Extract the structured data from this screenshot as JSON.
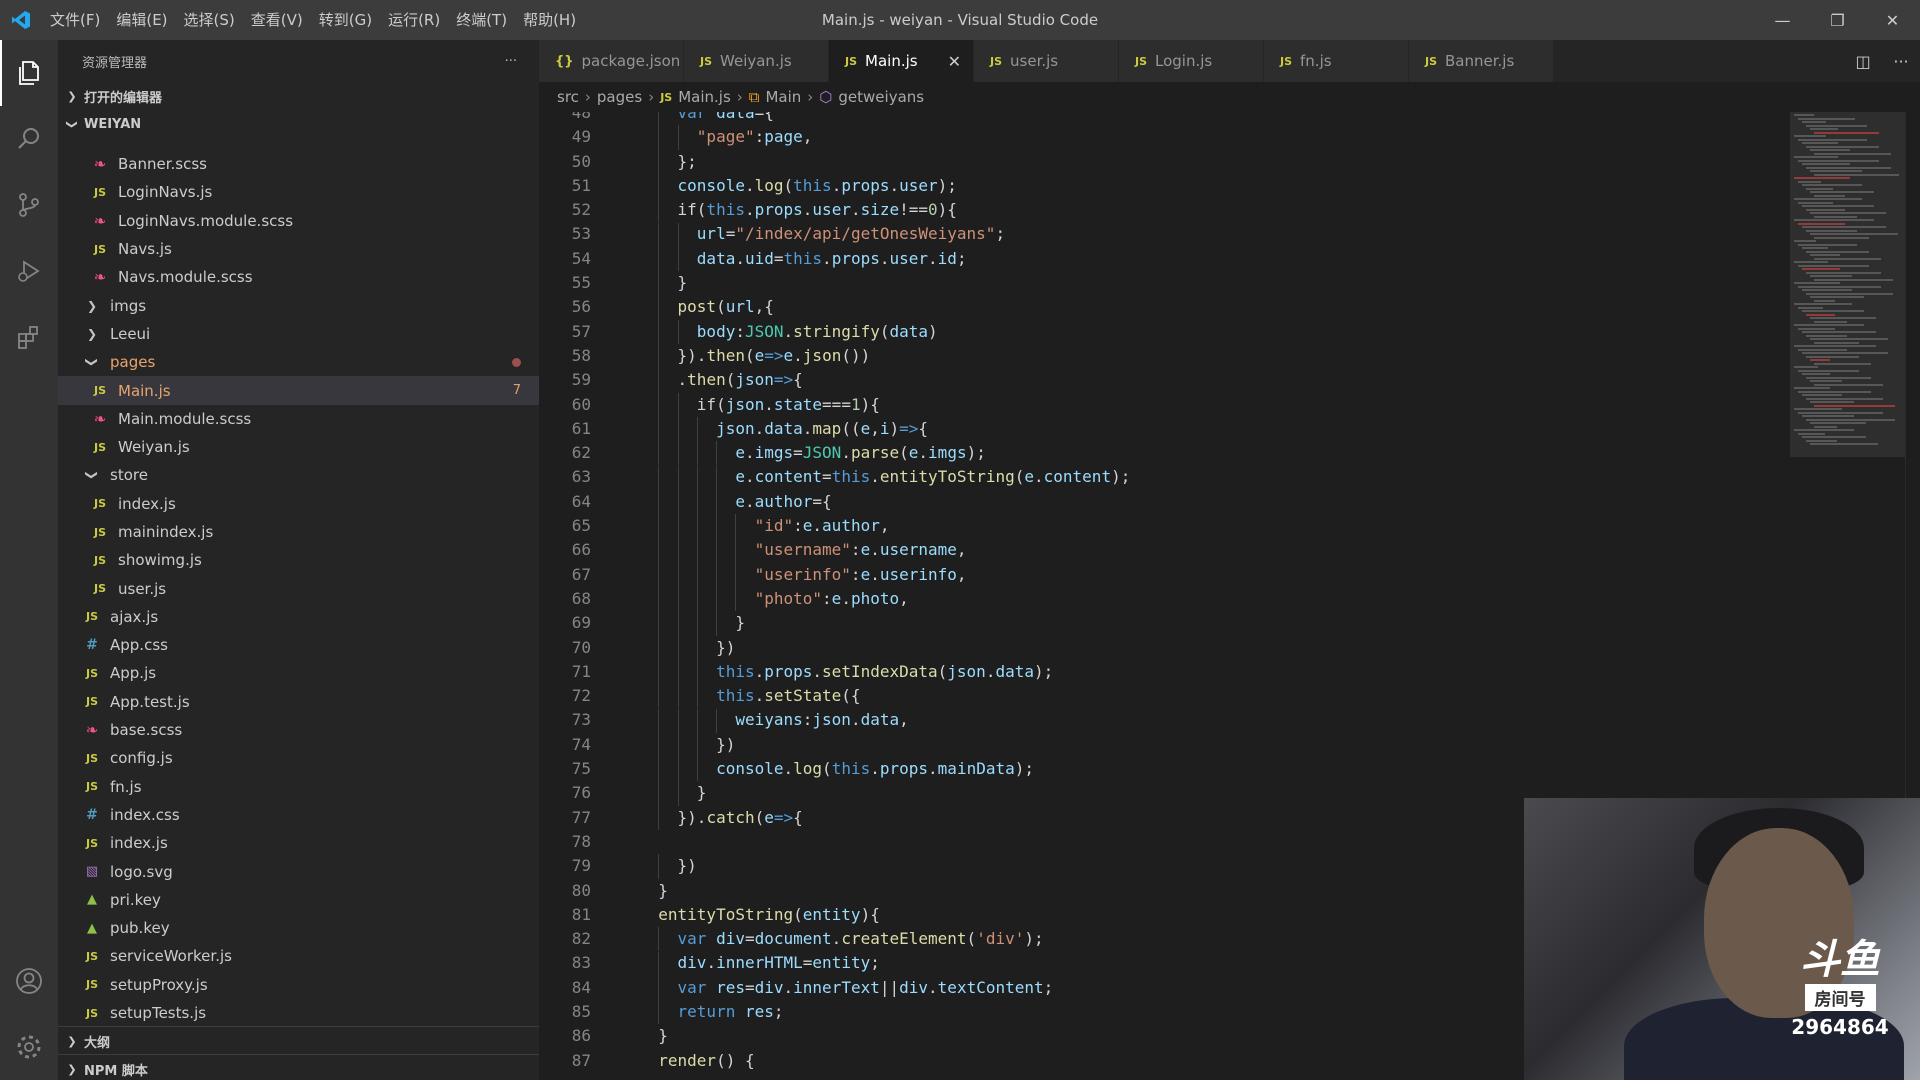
{
  "window": {
    "title": "Main.js - weiyan - Visual Studio Code",
    "menu": [
      "文件(F)",
      "编辑(E)",
      "选择(S)",
      "查看(V)",
      "转到(G)",
      "运行(R)",
      "终端(T)",
      "帮助(H)"
    ]
  },
  "sidebar": {
    "header": "资源管理器",
    "open_editors": "打开的编辑器",
    "project": "WEIYAN",
    "outline": "大纲",
    "npm": "NPM 脚本"
  },
  "tree": [
    {
      "name": "Banner.scss",
      "type": "scss",
      "indent": 3
    },
    {
      "name": "LoginNavs.js",
      "type": "js",
      "indent": 3
    },
    {
      "name": "LoginNavs.module.scss",
      "type": "scss",
      "indent": 3
    },
    {
      "name": "Navs.js",
      "type": "js",
      "indent": 3
    },
    {
      "name": "Navs.module.scss",
      "type": "scss",
      "indent": 3
    },
    {
      "name": "imgs",
      "type": "folder-closed",
      "indent": 2
    },
    {
      "name": "Leeui",
      "type": "folder-closed",
      "indent": 2
    },
    {
      "name": "pages",
      "type": "folder-open",
      "indent": 2,
      "modified": true
    },
    {
      "name": "Main.js",
      "type": "js",
      "indent": 3,
      "selected": true,
      "badge": "7"
    },
    {
      "name": "Main.module.scss",
      "type": "scss",
      "indent": 3
    },
    {
      "name": "Weiyan.js",
      "type": "js",
      "indent": 3
    },
    {
      "name": "store",
      "type": "folder-open",
      "indent": 2
    },
    {
      "name": "index.js",
      "type": "js",
      "indent": 3
    },
    {
      "name": "mainindex.js",
      "type": "js",
      "indent": 3
    },
    {
      "name": "showimg.js",
      "type": "js",
      "indent": 3
    },
    {
      "name": "user.js",
      "type": "js",
      "indent": 3
    },
    {
      "name": "ajax.js",
      "type": "js",
      "indent": 2
    },
    {
      "name": "App.css",
      "type": "css",
      "indent": 2
    },
    {
      "name": "App.js",
      "type": "js",
      "indent": 2
    },
    {
      "name": "App.test.js",
      "type": "js",
      "indent": 2
    },
    {
      "name": "base.scss",
      "type": "scss",
      "indent": 2
    },
    {
      "name": "config.js",
      "type": "js",
      "indent": 2
    },
    {
      "name": "fn.js",
      "type": "js",
      "indent": 2
    },
    {
      "name": "index.css",
      "type": "css",
      "indent": 2
    },
    {
      "name": "index.js",
      "type": "js",
      "indent": 2
    },
    {
      "name": "logo.svg",
      "type": "svg",
      "indent": 2
    },
    {
      "name": "pri.key",
      "type": "key",
      "indent": 2
    },
    {
      "name": "pub.key",
      "type": "key",
      "indent": 2
    },
    {
      "name": "serviceWorker.js",
      "type": "js",
      "indent": 2
    },
    {
      "name": "setupProxy.js",
      "type": "js",
      "indent": 2
    },
    {
      "name": "setupTests.js",
      "type": "js",
      "indent": 2
    }
  ],
  "tabs": [
    {
      "label": "package.json",
      "icon": "{}",
      "active": false
    },
    {
      "label": "Weiyan.js",
      "icon": "JS",
      "active": false
    },
    {
      "label": "Main.js",
      "icon": "JS",
      "active": true
    },
    {
      "label": "user.js",
      "icon": "JS",
      "active": false
    },
    {
      "label": "Login.js",
      "icon": "JS",
      "active": false
    },
    {
      "label": "fn.js",
      "icon": "JS",
      "active": false
    },
    {
      "label": "Banner.js",
      "icon": "JS",
      "active": false
    }
  ],
  "breadcrumb": {
    "src": "src",
    "pages": "pages",
    "file": "Main.js",
    "cls": "Main",
    "method": "getweiyans"
  },
  "code": {
    "first_line": 48,
    "lines": [
      [
        [
          2,
          ""
        ],
        [
          "k",
          "var "
        ],
        [
          "p",
          "data"
        ],
        [
          "",
          "={"
        ]
      ],
      [
        [
          3,
          ""
        ],
        [
          "s",
          "\"page\""
        ],
        [
          "",
          ":"
        ],
        [
          "p",
          "page"
        ],
        [
          "",
          ","
        ]
      ],
      [
        [
          2,
          ""
        ],
        [
          "",
          "};"
        ]
      ],
      [
        [
          2,
          ""
        ],
        [
          "p",
          "console"
        ],
        [
          "",
          "."
        ],
        [
          "f",
          "log"
        ],
        [
          "",
          "("
        ],
        [
          "k",
          "this"
        ],
        [
          "",
          "."
        ],
        [
          "p",
          "props"
        ],
        [
          "",
          "."
        ],
        [
          "p",
          "user"
        ],
        [
          "",
          ");"
        ]
      ],
      [
        [
          2,
          ""
        ],
        [
          "",
          "if("
        ],
        [
          "k",
          "this"
        ],
        [
          "",
          "."
        ],
        [
          "p",
          "props"
        ],
        [
          "",
          "."
        ],
        [
          "p",
          "user"
        ],
        [
          "",
          "."
        ],
        [
          "p",
          "size"
        ],
        [
          "",
          "!=="
        ],
        [
          "n",
          "0"
        ],
        [
          "",
          "){"
        ]
      ],
      [
        [
          3,
          ""
        ],
        [
          "p",
          "url"
        ],
        [
          "",
          "="
        ],
        [
          "s",
          "\"/index/api/getOnesWeiyans\""
        ],
        [
          "",
          ";"
        ]
      ],
      [
        [
          3,
          ""
        ],
        [
          "p",
          "data"
        ],
        [
          "",
          "."
        ],
        [
          "p",
          "uid"
        ],
        [
          "",
          "="
        ],
        [
          "k",
          "this"
        ],
        [
          "",
          "."
        ],
        [
          "p",
          "props"
        ],
        [
          "",
          "."
        ],
        [
          "p",
          "user"
        ],
        [
          "",
          "."
        ],
        [
          "p",
          "id"
        ],
        [
          "",
          ";"
        ]
      ],
      [
        [
          2,
          ""
        ],
        [
          "",
          "}"
        ]
      ],
      [
        [
          2,
          ""
        ],
        [
          "f",
          "post"
        ],
        [
          "",
          "("
        ],
        [
          "p",
          "url"
        ],
        [
          "",
          ",{"
        ]
      ],
      [
        [
          3,
          ""
        ],
        [
          "p",
          "body"
        ],
        [
          "",
          ":"
        ],
        [
          "c",
          "JSON"
        ],
        [
          "",
          "."
        ],
        [
          "f",
          "stringify"
        ],
        [
          "",
          "("
        ],
        [
          "p",
          "data"
        ],
        [
          "",
          ")"
        ]
      ],
      [
        [
          2,
          ""
        ],
        [
          "",
          "})."
        ],
        [
          "f",
          "then"
        ],
        [
          "",
          "("
        ],
        [
          "p",
          "e"
        ],
        [
          "k",
          "=>"
        ],
        [
          "p",
          "e"
        ],
        [
          "",
          "."
        ],
        [
          "f",
          "json"
        ],
        [
          "",
          "())"
        ]
      ],
      [
        [
          2,
          ""
        ],
        [
          "",
          "."
        ],
        [
          "f",
          "then"
        ],
        [
          "",
          "("
        ],
        [
          "p",
          "json"
        ],
        [
          "k",
          "=>"
        ],
        [
          "",
          "{"
        ]
      ],
      [
        [
          3,
          ""
        ],
        [
          "",
          "if("
        ],
        [
          "p",
          "json"
        ],
        [
          "",
          "."
        ],
        [
          "p",
          "state"
        ],
        [
          "",
          "==="
        ],
        [
          "n",
          "1"
        ],
        [
          "",
          "){"
        ]
      ],
      [
        [
          4,
          ""
        ],
        [
          "p",
          "json"
        ],
        [
          "",
          "."
        ],
        [
          "p",
          "data"
        ],
        [
          "",
          "."
        ],
        [
          "f",
          "map"
        ],
        [
          "",
          "(("
        ],
        [
          "p",
          "e"
        ],
        [
          "",
          ","
        ],
        [
          "p",
          "i"
        ],
        [
          "",
          ")"
        ],
        [
          "k",
          "=>"
        ],
        [
          "",
          "{"
        ]
      ],
      [
        [
          5,
          ""
        ],
        [
          "p",
          "e"
        ],
        [
          "",
          "."
        ],
        [
          "p",
          "imgs"
        ],
        [
          "",
          "="
        ],
        [
          "c",
          "JSON"
        ],
        [
          "",
          "."
        ],
        [
          "f",
          "parse"
        ],
        [
          "",
          "("
        ],
        [
          "p",
          "e"
        ],
        [
          "",
          "."
        ],
        [
          "p",
          "imgs"
        ],
        [
          "",
          ");"
        ]
      ],
      [
        [
          5,
          ""
        ],
        [
          "p",
          "e"
        ],
        [
          "",
          "."
        ],
        [
          "p",
          "content"
        ],
        [
          "",
          "="
        ],
        [
          "k",
          "this"
        ],
        [
          "",
          "."
        ],
        [
          "f",
          "entityToString"
        ],
        [
          "",
          "("
        ],
        [
          "p",
          "e"
        ],
        [
          "",
          "."
        ],
        [
          "p",
          "content"
        ],
        [
          "",
          ");"
        ]
      ],
      [
        [
          5,
          ""
        ],
        [
          "p",
          "e"
        ],
        [
          "",
          "."
        ],
        [
          "p",
          "author"
        ],
        [
          "",
          "={"
        ]
      ],
      [
        [
          6,
          ""
        ],
        [
          "s",
          "\"id\""
        ],
        [
          "",
          ":"
        ],
        [
          "p",
          "e"
        ],
        [
          "",
          "."
        ],
        [
          "p",
          "author"
        ],
        [
          "",
          ","
        ]
      ],
      [
        [
          6,
          ""
        ],
        [
          "s",
          "\"username\""
        ],
        [
          "",
          ":"
        ],
        [
          "p",
          "e"
        ],
        [
          "",
          "."
        ],
        [
          "p",
          "username"
        ],
        [
          "",
          ","
        ]
      ],
      [
        [
          6,
          ""
        ],
        [
          "s",
          "\"userinfo\""
        ],
        [
          "",
          ":"
        ],
        [
          "p",
          "e"
        ],
        [
          "",
          "."
        ],
        [
          "p",
          "userinfo"
        ],
        [
          "",
          ","
        ]
      ],
      [
        [
          6,
          ""
        ],
        [
          "s",
          "\"photo\""
        ],
        [
          "",
          ":"
        ],
        [
          "p",
          "e"
        ],
        [
          "",
          "."
        ],
        [
          "p",
          "photo"
        ],
        [
          "",
          ","
        ]
      ],
      [
        [
          5,
          ""
        ],
        [
          "",
          "}"
        ]
      ],
      [
        [
          4,
          ""
        ],
        [
          "",
          "})"
        ]
      ],
      [
        [
          4,
          ""
        ],
        [
          "k",
          "this"
        ],
        [
          "",
          "."
        ],
        [
          "p",
          "props"
        ],
        [
          "",
          "."
        ],
        [
          "f",
          "setIndexData"
        ],
        [
          "",
          "("
        ],
        [
          "p",
          "json"
        ],
        [
          "",
          "."
        ],
        [
          "p",
          "data"
        ],
        [
          "",
          ");"
        ]
      ],
      [
        [
          4,
          ""
        ],
        [
          "k",
          "this"
        ],
        [
          "",
          "."
        ],
        [
          "f",
          "setState"
        ],
        [
          "",
          "({"
        ]
      ],
      [
        [
          5,
          ""
        ],
        [
          "p",
          "weiyans"
        ],
        [
          "",
          ":"
        ],
        [
          "p",
          "json"
        ],
        [
          "",
          "."
        ],
        [
          "p",
          "data"
        ],
        [
          "",
          ","
        ]
      ],
      [
        [
          4,
          ""
        ],
        [
          "",
          "})"
        ]
      ],
      [
        [
          4,
          ""
        ],
        [
          "p",
          "console"
        ],
        [
          "",
          "."
        ],
        [
          "f",
          "log"
        ],
        [
          "",
          "("
        ],
        [
          "k",
          "this"
        ],
        [
          "",
          "."
        ],
        [
          "p",
          "props"
        ],
        [
          "",
          "."
        ],
        [
          "p",
          "mainData"
        ],
        [
          "",
          ");"
        ]
      ],
      [
        [
          3,
          ""
        ],
        [
          "",
          "}"
        ]
      ],
      [
        [
          2,
          ""
        ],
        [
          "",
          "})."
        ],
        [
          "f",
          "catch"
        ],
        [
          "",
          "("
        ],
        [
          "p",
          "e"
        ],
        [
          "k",
          "=>"
        ],
        [
          "",
          "{"
        ]
      ],
      [
        [
          0,
          ""
        ]
      ],
      [
        [
          2,
          ""
        ],
        [
          "",
          "})"
        ]
      ],
      [
        [
          1,
          ""
        ],
        [
          "",
          "}"
        ]
      ],
      [
        [
          1,
          ""
        ],
        [
          "f",
          "entityToString"
        ],
        [
          "",
          "("
        ],
        [
          "p",
          "entity"
        ],
        [
          "",
          "){"
        ]
      ],
      [
        [
          2,
          ""
        ],
        [
          "k",
          "var "
        ],
        [
          "p",
          "div"
        ],
        [
          "",
          "="
        ],
        [
          "p",
          "document"
        ],
        [
          "",
          "."
        ],
        [
          "f",
          "createElement"
        ],
        [
          "",
          "("
        ],
        [
          "s",
          "'div'"
        ],
        [
          "",
          ");"
        ]
      ],
      [
        [
          2,
          ""
        ],
        [
          "p",
          "div"
        ],
        [
          "",
          "."
        ],
        [
          "p",
          "innerHTML"
        ],
        [
          "",
          "="
        ],
        [
          "p",
          "entity"
        ],
        [
          "",
          ";"
        ]
      ],
      [
        [
          2,
          ""
        ],
        [
          "k",
          "var "
        ],
        [
          "p",
          "res"
        ],
        [
          "",
          "="
        ],
        [
          "p",
          "div"
        ],
        [
          "",
          "."
        ],
        [
          "p",
          "innerText"
        ],
        [
          "",
          "||"
        ],
        [
          "p",
          "div"
        ],
        [
          "",
          "."
        ],
        [
          "p",
          "textContent"
        ],
        [
          "",
          ";"
        ]
      ],
      [
        [
          2,
          ""
        ],
        [
          "k",
          "return "
        ],
        [
          "p",
          "res"
        ],
        [
          "",
          ";"
        ]
      ],
      [
        [
          1,
          ""
        ],
        [
          "",
          "}"
        ]
      ],
      [
        [
          1,
          ""
        ],
        [
          "f",
          "render"
        ],
        [
          "",
          "() {"
        ]
      ]
    ]
  },
  "webcam": {
    "brand": "斗鱼",
    "room_label": "房间号",
    "room_number": "2964864"
  }
}
